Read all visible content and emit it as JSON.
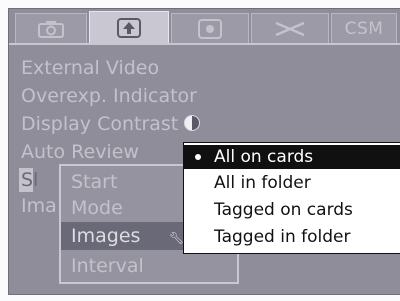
{
  "tabs": [
    {
      "icon": "camera-icon",
      "active": false
    },
    {
      "icon": "playback-icon",
      "active": true
    },
    {
      "icon": "settings-icon",
      "active": false
    },
    {
      "icon": "tools-icon",
      "active": false
    },
    {
      "label": "CSM",
      "active": false
    }
  ],
  "menu": {
    "external_video": "External Video",
    "overexp_indicator": "Overexp. Indicator",
    "display_contrast": "Display Contrast",
    "auto_review": "Auto Review",
    "slideshow_partial": "Sl",
    "image_partial": "Ima"
  },
  "submenu": {
    "start": "Start",
    "mode": "Mode",
    "images": "Images",
    "interval": "Interval"
  },
  "dropdown": {
    "options": [
      "All on cards",
      "All in folder",
      "Tagged on cards",
      "Tagged in folder"
    ],
    "selected": "All on cards"
  }
}
